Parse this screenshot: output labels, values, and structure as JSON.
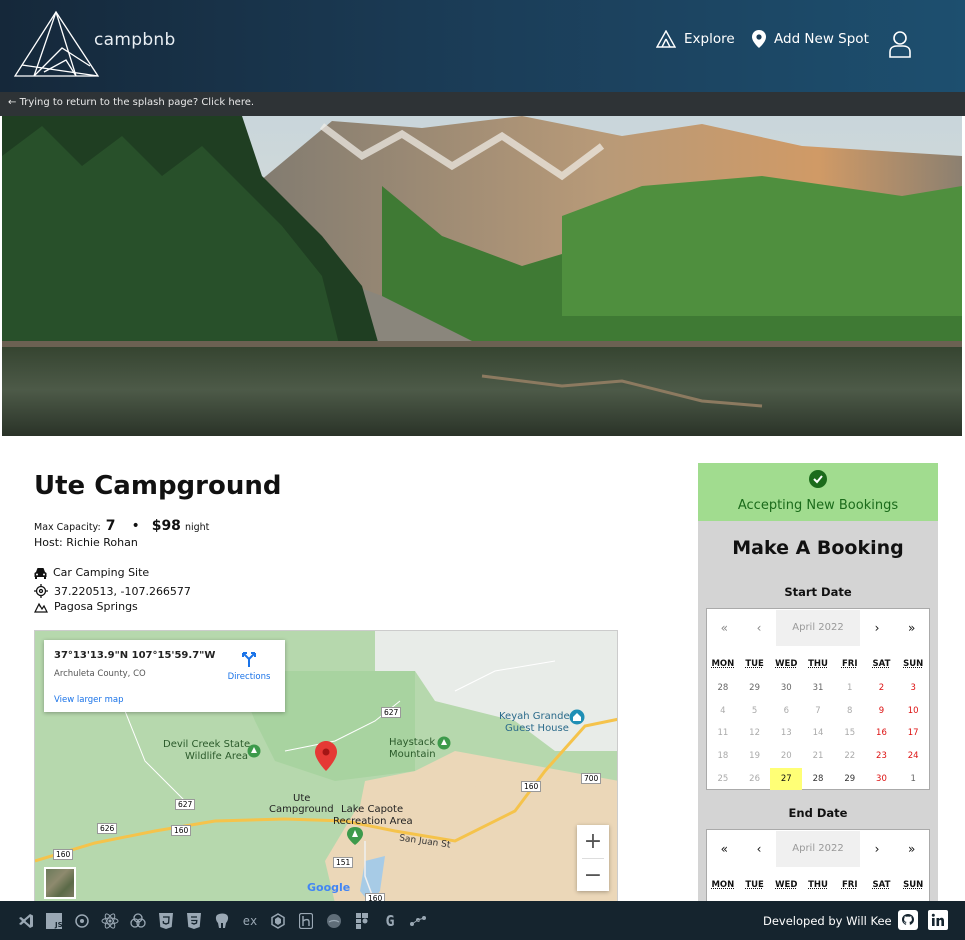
{
  "header": {
    "brand": "campbnb",
    "nav": {
      "explore_label": "Explore",
      "add_label": "Add New Spot"
    }
  },
  "splash_bar": {
    "text": "Trying to return to the splash page? Click here."
  },
  "spot": {
    "title": "Ute Campground",
    "capacity_label": "Max Capacity:",
    "capacity_value": "7",
    "separator": "•",
    "price": "$98",
    "price_unit": "night",
    "host": "Host: Richie Rohan",
    "type": "Car Camping Site",
    "coordinates": "37.220513, -107.266577",
    "location": "Pagosa Springs"
  },
  "map": {
    "card_coords": "37°13'13.9\"N 107°15'59.7\"W",
    "card_county": "Archuleta County, CO",
    "card_link": "View larger map",
    "card_directions": "Directions",
    "places": {
      "devil_creek_1": "Devil Creek State",
      "devil_creek_2": "Wildlife Area",
      "haystack_1": "Haystack",
      "haystack_2": "Mountain",
      "keyah_1": "Keyah Grande",
      "keyah_2": "Guest House",
      "ute_1": "Ute",
      "ute_2": "Campground",
      "lake_capote_1": "Lake Capote",
      "lake_capote_2": "Recreation Area",
      "san_juan": "San Juan St"
    },
    "road_badges": [
      "627",
      "700",
      "160",
      "627",
      "626",
      "160",
      "160",
      "151",
      "160"
    ],
    "zoom_in": "+",
    "zoom_out": "−",
    "google": "Google"
  },
  "booking": {
    "status": "Accepting New Bookings",
    "heading": "Make A Booking",
    "start_label": "Start Date",
    "end_label": "End Date",
    "nav": {
      "first": "«",
      "prev": "‹",
      "next": "›",
      "last": "»"
    },
    "month": "April 2022",
    "weekdays": [
      "MON",
      "TUE",
      "WED",
      "THU",
      "FRI",
      "SAT",
      "SUN"
    ],
    "start_weeks": [
      [
        "28",
        "29",
        "30",
        "31",
        "1",
        "2",
        "3"
      ],
      [
        "4",
        "5",
        "6",
        "7",
        "8",
        "9",
        "10"
      ],
      [
        "11",
        "12",
        "13",
        "14",
        "15",
        "16",
        "17"
      ],
      [
        "18",
        "19",
        "20",
        "21",
        "22",
        "23",
        "24"
      ],
      [
        "25",
        "26",
        "27",
        "28",
        "29",
        "30",
        "1"
      ]
    ],
    "today": "27"
  },
  "footer": {
    "credit": "Developed by Will Kee",
    "tech_icons": [
      "vscode",
      "javascript",
      "redux",
      "react",
      "sqlalchemy",
      "html5",
      "css3",
      "postgresql",
      "express",
      "sequelize",
      "heroku",
      "flask",
      "npm",
      "google"
    ]
  },
  "colors": {
    "header_dark": "#15283a",
    "header_light": "#1d4f6f",
    "accept_bg": "#a1dc8f",
    "accept_text": "#1b6b1b",
    "today_bg": "#ffff76",
    "weekend": "#dd1111",
    "footer_bg": "#15242e"
  }
}
